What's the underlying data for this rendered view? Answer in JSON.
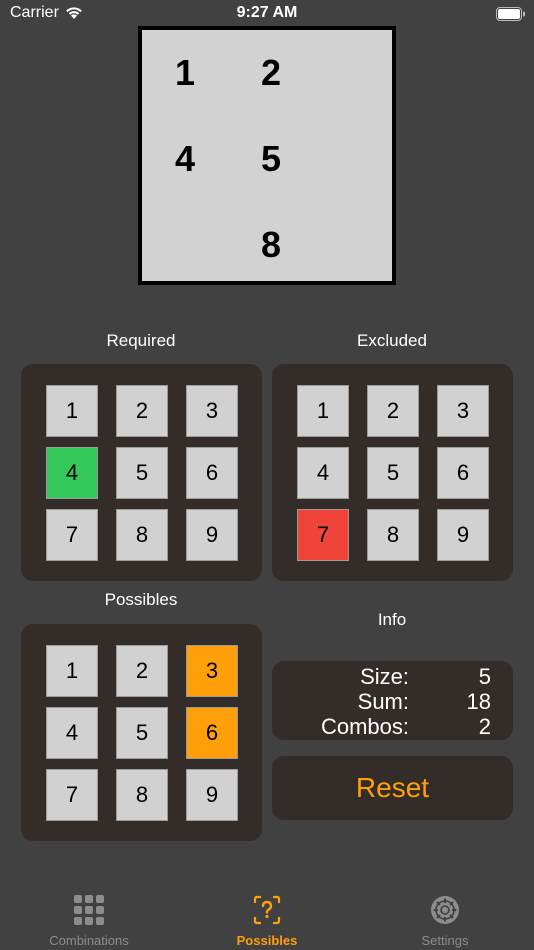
{
  "status_bar": {
    "carrier": "Carrier",
    "time": "9:27 AM"
  },
  "display": {
    "cells": [
      {
        "row": 0,
        "col": 0,
        "value": "1"
      },
      {
        "row": 0,
        "col": 1,
        "value": "2"
      },
      {
        "row": 1,
        "col": 0,
        "value": "4"
      },
      {
        "row": 1,
        "col": 1,
        "value": "5"
      },
      {
        "row": 2,
        "col": 1,
        "value": "8"
      }
    ]
  },
  "required": {
    "label": "Required",
    "keys": [
      "1",
      "2",
      "3",
      "4",
      "5",
      "6",
      "7",
      "8",
      "9"
    ],
    "selected": "4",
    "selected_color": "#34c759"
  },
  "excluded": {
    "label": "Excluded",
    "keys": [
      "1",
      "2",
      "3",
      "4",
      "5",
      "6",
      "7",
      "8",
      "9"
    ],
    "selected": "7",
    "selected_color": "#f0443a"
  },
  "possibles": {
    "label": "Possibles",
    "keys": [
      "1",
      "2",
      "3",
      "4",
      "5",
      "6",
      "7",
      "8",
      "9"
    ],
    "highlighted": [
      "3",
      "6"
    ],
    "highlight_color": "#ff9f0a"
  },
  "info": {
    "label": "Info",
    "size_label": "Size:",
    "size_value": "5",
    "sum_label": "Sum:",
    "sum_value": "18",
    "combos_label": "Combos:",
    "combos_value": "2"
  },
  "reset_label": "Reset",
  "tabs": [
    {
      "label": "Combinations",
      "icon": "grid-icon",
      "active": false
    },
    {
      "label": "Possibles",
      "icon": "question-icon",
      "active": true
    },
    {
      "label": "Settings",
      "icon": "gear-icon",
      "active": false
    }
  ],
  "colors": {
    "accent": "#ff9f0a",
    "background": "#414141",
    "panel": "#342c29"
  }
}
